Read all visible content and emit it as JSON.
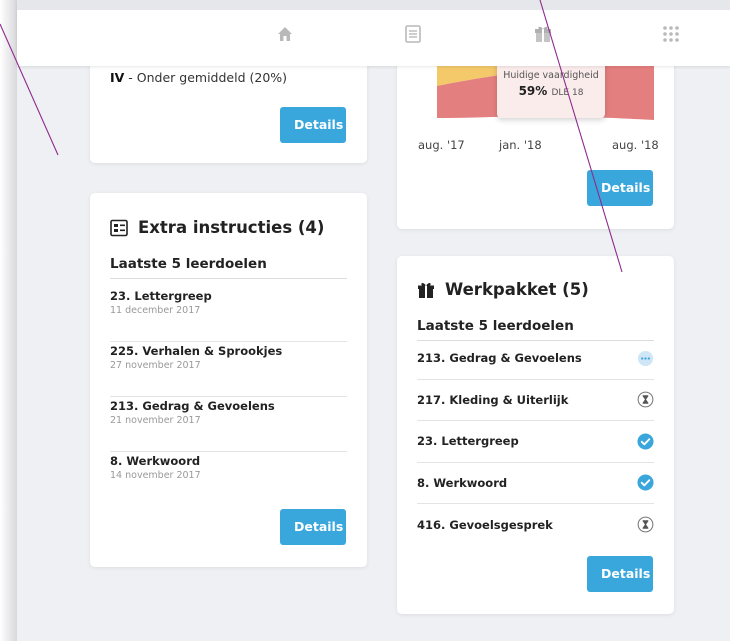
{
  "nav": {
    "icons": [
      "home-icon",
      "list-icon",
      "gift-icon",
      "apps-grid-icon"
    ]
  },
  "level_card": {
    "level_code": "IV",
    "level_text": " - Onder gemiddeld (20%)",
    "details_label": "Details"
  },
  "chart_card": {
    "details_label": "Details",
    "chart_data": {
      "type": "area",
      "x": [
        "aug. '17",
        "jan. '18",
        "aug. '18"
      ],
      "tooltip_title": "Huidige vaardigheid",
      "tooltip_value": "59%",
      "tooltip_suffix": "DLE 18",
      "colors": {
        "upper_band": "#f4c96a",
        "lower_band": "#e47f7f"
      }
    }
  },
  "instructions_card": {
    "title": "Extra instructies (4)",
    "subtitle": "Laatste 5 leerdoelen",
    "details_label": "Details",
    "items": [
      {
        "name": "23. Lettergreep",
        "date": "11 december 2017"
      },
      {
        "name": "225. Verhalen & Sprookjes",
        "date": "27 november 2017"
      },
      {
        "name": "213. Gedrag & Gevoelens",
        "date": "21 november 2017"
      },
      {
        "name": "8. Werkwoord",
        "date": "14 november 2017"
      }
    ]
  },
  "workpackage_card": {
    "title": "Werkpakket (5)",
    "subtitle": "Laatste 5 leerdoelen",
    "details_label": "Details",
    "items": [
      {
        "name": "213. Gedrag & Gevoelens",
        "status": "in-progress"
      },
      {
        "name": "217. Kleding & Uiterlijk",
        "status": "pending"
      },
      {
        "name": "23. Lettergreep",
        "status": "completed"
      },
      {
        "name": "8. Werkwoord",
        "status": "completed"
      },
      {
        "name": "416. Gevoelsgesprek",
        "status": "pending"
      }
    ]
  },
  "colors": {
    "accent": "#3aa7dc",
    "annotation_line": "#8e2a8e"
  }
}
